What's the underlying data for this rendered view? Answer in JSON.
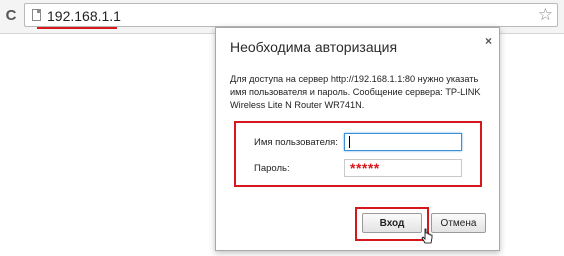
{
  "browser": {
    "url": "192.168.1.1",
    "reload_icon": "reload-icon",
    "star_icon": "bookmark-star-icon",
    "highlight_color": "#d6181c"
  },
  "dialog": {
    "title": "Необходима авторизация",
    "description": "Для доступа на сервер http://192.168.1.1:80 нужно указать имя пользователя и пароль. Сообщение сервера: TP-LINK Wireless Lite N Router WR741N.",
    "close_label": "×",
    "username_label": "Имя пользователя:",
    "username_value": "",
    "password_label": "Пароль:",
    "password_value": "*****",
    "login_button": "Вход",
    "cancel_button": "Отмена"
  }
}
